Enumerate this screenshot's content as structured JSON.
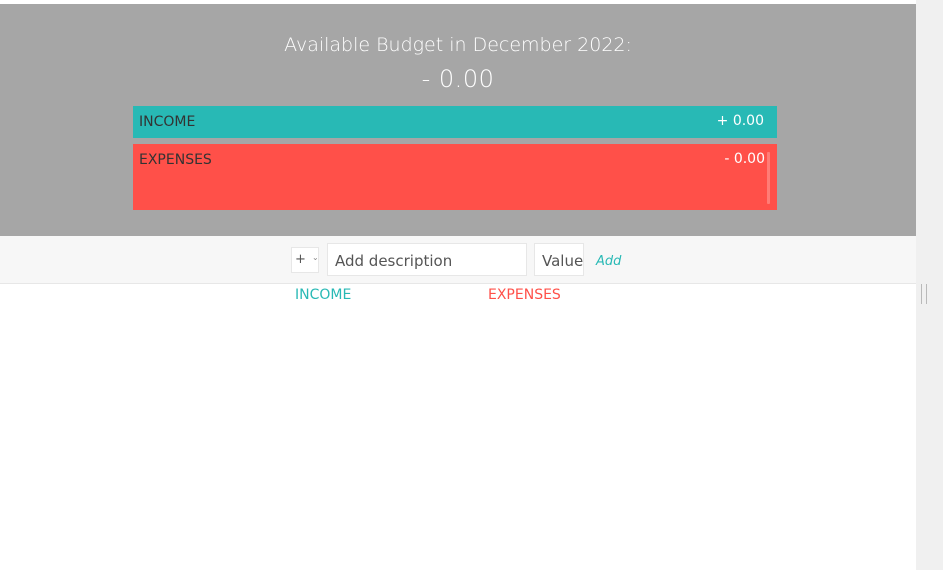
{
  "header": {
    "title_prefix": "Available Budget in ",
    "month": "December 2022",
    "title_suffix": ":",
    "budget": "- 0.00"
  },
  "summary": {
    "income_label": "INCOME",
    "income_value": "+ 0.00",
    "expenses_label": "EXPENSES",
    "expenses_value": "- 0.00"
  },
  "add_form": {
    "type_value": "+",
    "description_placeholder": "Add description",
    "value_placeholder": "Value",
    "add_label": "Add"
  },
  "lists": {
    "income_title": "INCOME",
    "expenses_title": "EXPENSES"
  },
  "colors": {
    "header_bg": "#a6a6a6",
    "income": "#28b9b5",
    "expenses": "#ff5049"
  }
}
